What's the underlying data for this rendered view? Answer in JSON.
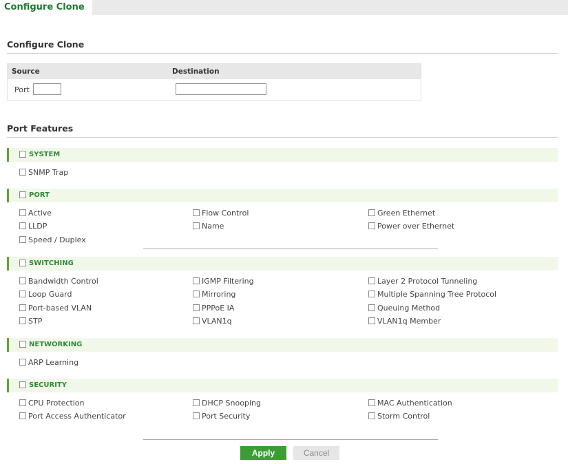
{
  "tab": {
    "label": "Configure Clone"
  },
  "configure_clone": {
    "title": "Configure Clone",
    "source_header": "Source",
    "destination_header": "Destination",
    "port_label": "Port",
    "port_value": "",
    "destination_value": ""
  },
  "port_features": {
    "title": "Port Features",
    "system": {
      "label": "SYSTEM",
      "items": [
        "SNMP Trap"
      ]
    },
    "port": {
      "label": "PORT",
      "items": [
        "Active",
        "Flow Control",
        "Green Ethernet",
        "LLDP",
        "Name",
        "Power over Ethernet",
        "Speed / Duplex"
      ]
    },
    "switching": {
      "label": "SWITCHING",
      "items": [
        "Bandwidth Control",
        "IGMP Filtering",
        "Layer 2 Protocol Tunneling",
        "Loop Guard",
        "Mirroring",
        "Multiple Spanning Tree Protocol",
        "Port-based VLAN",
        "PPPoE IA",
        "Queuing Method",
        "STP",
        "VLAN1q",
        "VLAN1q Member"
      ]
    },
    "networking": {
      "label": "NETWORKING",
      "items": [
        "ARP Learning"
      ]
    },
    "security": {
      "label": "SECURITY",
      "items": [
        "CPU Protection",
        "DHCP Snooping",
        "MAC Authentication",
        "Port Access Authenticator",
        "Port Security",
        "Storm Control"
      ]
    }
  },
  "buttons": {
    "apply": "Apply",
    "cancel": "Cancel"
  },
  "colors": {
    "accent_green": "#3b9e34",
    "header_green": "#2e8b3a",
    "section_bg": "#f1f8e9"
  }
}
